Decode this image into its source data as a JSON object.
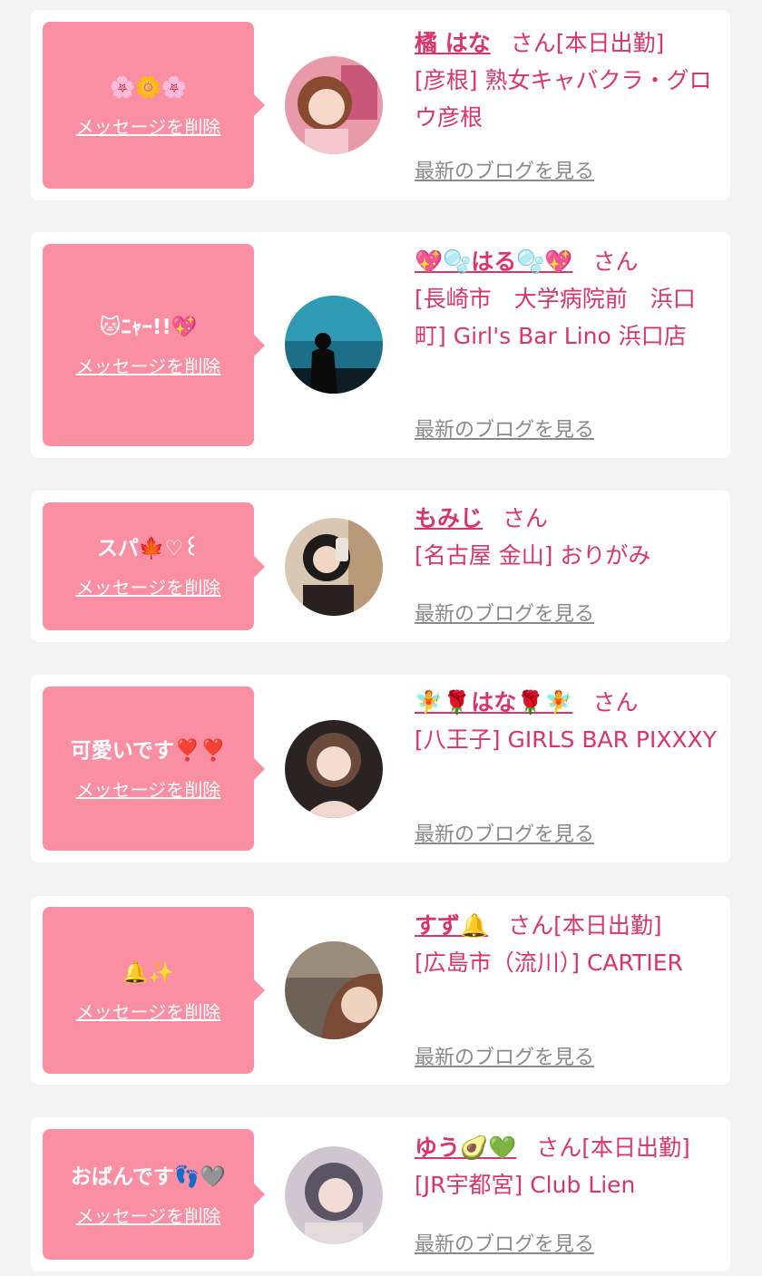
{
  "messages": [
    {
      "message": "🌸🌼🌸",
      "delete_label": "メッセージを削除",
      "name": "橘 はな",
      "honorific": "さん",
      "badge": "[本日出勤]",
      "shop": "[彦根] 熟女キャバクラ・グロウ彦根",
      "blog_link": "最新のブログを見る",
      "avatar": "anime-girl-photo"
    },
    {
      "message": "🐱ﾆｬｰ!!💖",
      "delete_label": "メッセージを削除",
      "name": "💖🫧はる🫧💖",
      "honorific": "さん",
      "badge": "",
      "shop": "[長崎市　大学病院前　浜口町] Girl's Bar Lino 浜口店",
      "blog_link": "最新のブログを見る",
      "avatar": "aquarium-silhouette-photo"
    },
    {
      "message": "スパ🍁♡꒰",
      "delete_label": "メッセージを削除",
      "name": "もみじ",
      "honorific": "さん",
      "badge": "",
      "shop": "[名古屋 金山] おりがみ",
      "blog_link": "最新のブログを見る",
      "avatar": "mirror-selfie-photo"
    },
    {
      "message": "可愛いです❣️❣️",
      "delete_label": "メッセージを削除",
      "name": "🧚🌹はな🌹🧚",
      "honorific": "さん",
      "badge": "",
      "shop": "[八王子] GIRLS BAR PIXXXY",
      "blog_link": "最新のブログを見る",
      "avatar": "portrait-photo"
    },
    {
      "message": "🔔✨",
      "delete_label": "メッセージを削除",
      "name": "すず🔔",
      "honorific": "さん",
      "badge": "[本日出勤]",
      "shop": "[広島市（流川）] CARTIER",
      "blog_link": "最新のブログを見る",
      "avatar": "side-profile-photo"
    },
    {
      "message": "おばんです👣🩶",
      "delete_label": "メッセージを削除",
      "name": "ゆう🥑💚",
      "honorific": "さん",
      "badge": "[本日出勤]",
      "shop": "[JR宇都宮] Club Lien",
      "blog_link": "最新のブログを見る",
      "avatar": "portrait-photo"
    }
  ],
  "colors": {
    "page_bg": "#f3f3f3",
    "card_bg": "#ffffff",
    "bubble_bg": "#fa8fa3",
    "accent_text": "#d9356a",
    "link_gray": "#8a8a8a"
  }
}
